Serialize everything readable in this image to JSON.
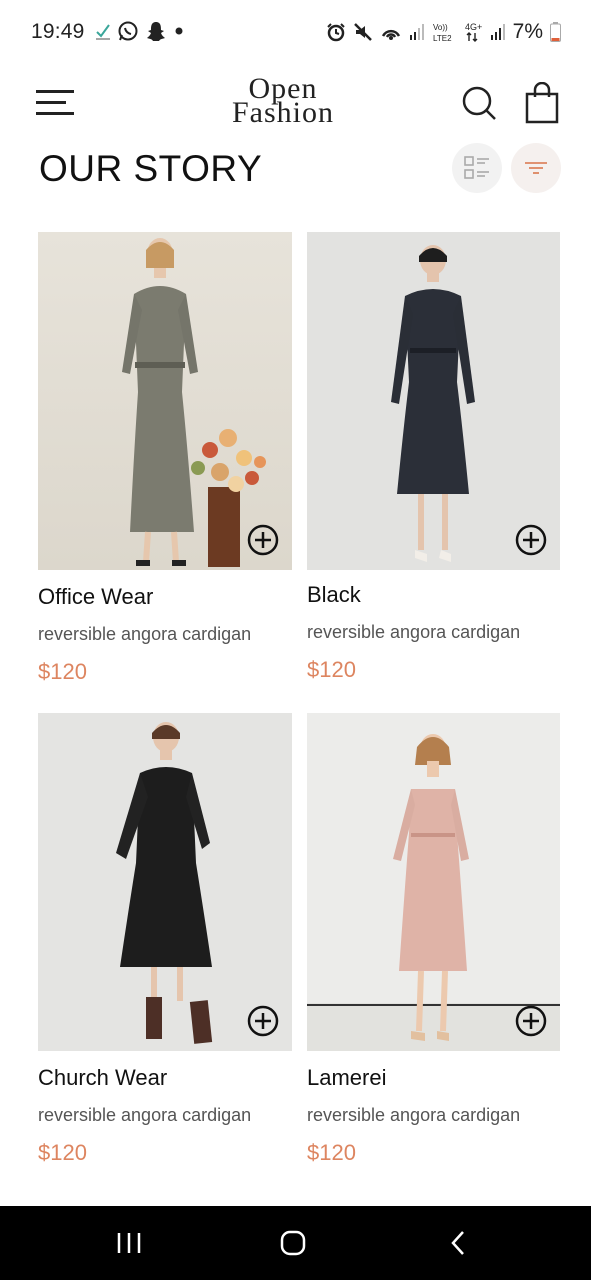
{
  "status_bar": {
    "time": "19:49",
    "battery": "7%",
    "icons": [
      "check-icon",
      "whatsapp-icon",
      "snapchat-icon",
      "dot-icon",
      "alarm-icon",
      "mute-icon",
      "hotspot-icon",
      "signal-icon",
      "volte-icon",
      "4g-icon",
      "signal-icon",
      "battery-icon"
    ]
  },
  "header": {
    "logo_line1": "Open",
    "logo_line2": "Fashion"
  },
  "page": {
    "title": "OUR STORY"
  },
  "products": [
    {
      "name": "Office Wear",
      "description": "reversible angora cardigan",
      "price": "$120"
    },
    {
      "name": "Black",
      "description": "reversible angora cardigan",
      "price": "$120"
    },
    {
      "name": "Church Wear",
      "description": "reversible angora cardigan",
      "price": "$120"
    },
    {
      "name": "Lamerei",
      "description": "reversible angora cardigan",
      "price": "$120"
    }
  ],
  "colors": {
    "accent": "#dd8560",
    "text": "#111111",
    "secondary_text": "#555555"
  },
  "nav_bar": {
    "icons": [
      "recents-icon",
      "home-icon",
      "back-icon"
    ]
  }
}
